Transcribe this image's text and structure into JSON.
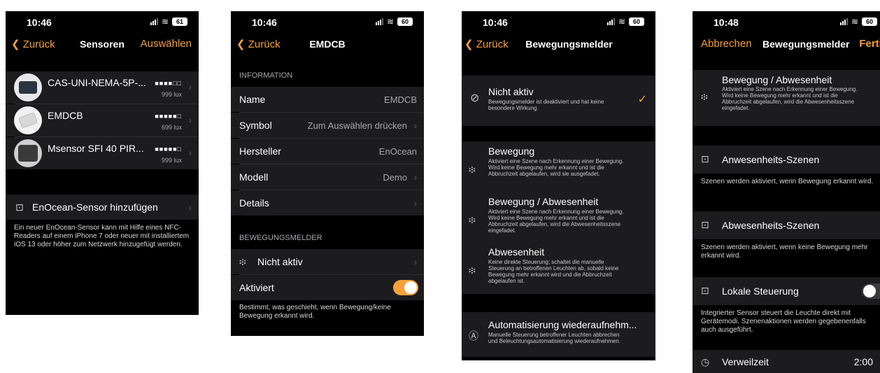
{
  "colors": {
    "accent": "#f5a03a",
    "cell": "#1c1c1e",
    "background": "#000000"
  },
  "status": {
    "battery": "61"
  },
  "p1": {
    "time": "10:46",
    "back": "Zurück",
    "title": "Sensoren",
    "action": "Auswählen",
    "sensors": [
      {
        "name": "CAS-UNI-NEMA-5P-...",
        "signal": "■■■■□□",
        "lux": "999 lux"
      },
      {
        "name": "EMDCB",
        "signal": "■■■■■□",
        "lux": "699 lux"
      },
      {
        "name": "Msensor SFI 40 PIR...",
        "signal": "■■■■■□",
        "lux": "999 lux"
      }
    ],
    "add_label": "EnOcean-Sensor hinzufügen",
    "add_footer": "Ein neuer EnOcean-Sensor kann mit Hilfe eines NFC-Readers auf einem iPhone 7 oder neuer mit installiertem iOS 13 oder höher zum Netzwerk hinzugefügt werden."
  },
  "p2": {
    "time": "10:46",
    "battery": "60",
    "back": "Zurück",
    "title": "EMDCB",
    "info_header": "INFORMATION",
    "rows": [
      {
        "label": "Name",
        "value": "EMDCB"
      },
      {
        "label": "Symbol",
        "value": "Zum Auswählen drücken"
      },
      {
        "label": "Hersteller",
        "value": "EnOcean"
      },
      {
        "label": "Modell",
        "value": "Demo"
      },
      {
        "label": "Details",
        "value": ""
      }
    ],
    "motion_header": "BEWEGUNGSMELDER",
    "motion_value": "Nicht aktiv",
    "activated_label": "Aktiviert",
    "activated_on": true,
    "footer": "Bestimmt, was geschieht, wenn Bewegung/keine Bewegung erkannt wird."
  },
  "p3": {
    "time": "10:46",
    "battery": "60",
    "back": "Zurück",
    "title": "Bewegungsmelder",
    "options": [
      {
        "title": "Nicht aktiv",
        "desc": "Bewegungsmelder ist deaktiviert und hat keine besondere Wirkung.",
        "checked": "✓"
      },
      {
        "title": "Bewegung",
        "desc": "Aktiviert eine Szene nach Erkennung einer Bewegung. Wird keine Bewegung mehr erkannt und ist die Abbruchzeit abgelaufen, wird sie ausgefadet."
      },
      {
        "title": "Bewegung / Abwesenheit",
        "desc": "Aktiviert eine Szene nach Erkennung einer Bewegung. Wird keine Bewegung mehr erkannt und ist die Abbruchzeit abgelaufen, wird die Abwesenheitsszene eingefadet."
      },
      {
        "title": "Abwesenheit",
        "desc": "Keine direkte Steuerung; schaltet die manuelle Steuerung an betroffenen Leuchten ab, sobald keine Bewegung mehr erkannt wird und die Abbruchzeit abgelaufen ist."
      }
    ],
    "resume_title": "Automatisierung wiederaufnehm...",
    "resume_desc": "Manuelle Steuerung betroffener Leuchten abbrechen und Beleuchtungsautomatisierung wiederaufnehmen."
  },
  "p4": {
    "time": "10:48",
    "battery": "60",
    "cancel": "Abbrechen",
    "title": "Bewegungsmelder",
    "done": "Fertig",
    "mode_title": "Bewegung / Abwesenheit",
    "mode_desc": "Aktiviert eine Szene nach Erkennung einer Bewegung. Wird keine Bewegung mehr erkannt und ist die Abbruchzeit abgelaufen, wird die Abwesenheitsszene eingefadet.",
    "presence_label": "Anwesenheits-Szenen",
    "presence_footer": "Szenen werden aktiviert, wenn Bewegung erkannt wird.",
    "absence_label": "Abwesenheits-Szenen",
    "absence_footer": "Szenen werden aktiviert, wenn keine Bewegung mehr erkannt wird.",
    "local_label": "Lokale Steuerung",
    "local_on": false,
    "local_footer": "Integrierter Sensor steuert die Leuchte direkt mit Gerätemodi. Szenenaktionen werden gegebenenfalls auch ausgeführt.",
    "dwell_label": "Verweilzeit",
    "dwell_value": "2:00"
  }
}
